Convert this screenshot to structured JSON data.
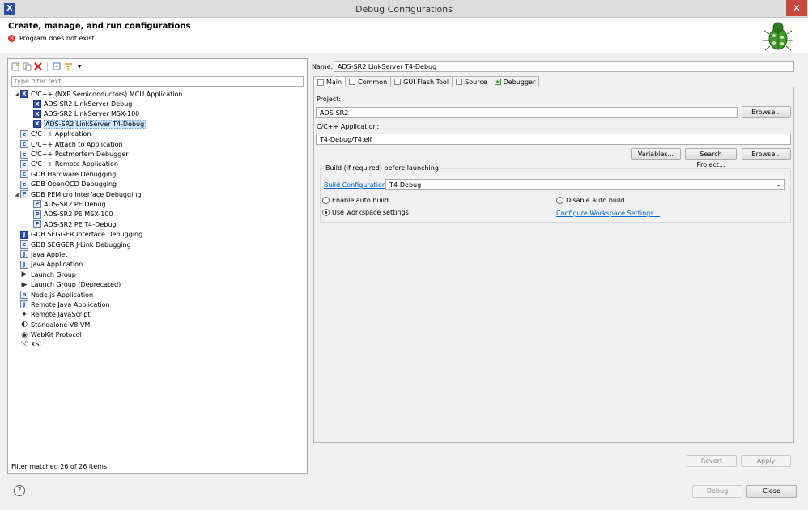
{
  "window": {
    "title": "Debug Configurations",
    "close_glyph": "✕"
  },
  "header": {
    "title": "Create, manage, and run configurations",
    "error_message": "Program does not exist",
    "icon": "bug-icon"
  },
  "left": {
    "toolbar_icons": [
      "new-config-icon",
      "duplicate-icon",
      "delete-icon",
      "collapse-all-icon",
      "filter-icon",
      "dropdown-arrow-icon"
    ],
    "filter_placeholder": "type filter text",
    "tree": [
      {
        "label": "C/C++ (NXP Semiconductors) MCU Application",
        "expanded": true,
        "icon": "mcu-app-icon",
        "children": [
          {
            "label": "ADS-SR2 LinkServer Debug",
            "icon": "mcu-config-icon"
          },
          {
            "label": "ADS-SR2 LinkServer MSX-100",
            "icon": "mcu-config-icon"
          },
          {
            "label": "ADS-SR2 LinkServer T4-Debug",
            "icon": "mcu-config-icon",
            "selected": true
          }
        ]
      },
      {
        "label": "C/C++ Application",
        "icon": "c-app-icon"
      },
      {
        "label": "C/C++ Attach to Application",
        "icon": "c-attach-icon"
      },
      {
        "label": "C/C++ Postmortem Debugger",
        "icon": "c-postmortem-icon"
      },
      {
        "label": "C/C++ Remote Application",
        "icon": "c-remote-icon"
      },
      {
        "label": "GDB Hardware Debugging",
        "icon": "gdb-hw-icon"
      },
      {
        "label": "GDB OpenOCD Debugging",
        "icon": "gdb-openocd-icon"
      },
      {
        "label": "GDB PEMicro Interface Debugging",
        "expanded": true,
        "icon": "pemicro-icon",
        "children": [
          {
            "label": "ADS-SR2 PE Debug",
            "icon": "pe-config-icon"
          },
          {
            "label": "ADS-SR2 PE MSX-100",
            "icon": "pe-config-icon"
          },
          {
            "label": "ADS-SR2 PE T4-Debug",
            "icon": "pe-config-icon"
          }
        ]
      },
      {
        "label": "GDB SEGGER Interface Debugging",
        "icon": "segger-icon"
      },
      {
        "label": "GDB SEGGER J-Link Debugging",
        "icon": "jlink-icon"
      },
      {
        "label": "Java Applet",
        "icon": "java-applet-icon"
      },
      {
        "label": "Java Application",
        "icon": "java-app-icon"
      },
      {
        "label": "Launch Group",
        "icon": "launch-group-icon"
      },
      {
        "label": "Launch Group (Deprecated)",
        "icon": "launch-group-deprecated-icon"
      },
      {
        "label": "Node.js Application",
        "icon": "nodejs-icon"
      },
      {
        "label": "Remote Java Application",
        "icon": "remote-java-icon"
      },
      {
        "label": "Remote JavaScript",
        "icon": "remote-js-icon"
      },
      {
        "label": "Standalone V8 VM",
        "icon": "v8-icon"
      },
      {
        "label": "WebKit Protocol",
        "icon": "webkit-icon"
      },
      {
        "label": "XSL",
        "icon": "xsl-icon"
      }
    ],
    "status": "Filter matched 26 of 26 items"
  },
  "right": {
    "name_label": "Name:",
    "name_value": "ADS-SR2 LinkServer T4-Debug",
    "tabs": [
      {
        "label": "Main",
        "active": true,
        "icon": "main-tab-icon"
      },
      {
        "label": "Common",
        "icon": "common-tab-icon"
      },
      {
        "label": "GUI Flash Tool",
        "icon": "flash-tool-icon"
      },
      {
        "label": "Source",
        "icon": "source-tab-icon"
      },
      {
        "label": "Debugger",
        "icon": "debugger-tab-icon"
      }
    ],
    "project_label": "Project:",
    "project_value": "ADS-SR2",
    "browse_label": "Browse...",
    "app_label": "C/C++ Application:",
    "app_value": "T4-Debug/T4.elf",
    "variables_label": "Variables...",
    "search_project_label": "Search Project...",
    "build_group_title": "Build (if required) before launching",
    "build_config_link": "Build Configuration:",
    "build_config_value": "T4-Debug",
    "enable_auto_build": "Enable auto build",
    "disable_auto_build": "Disable auto build",
    "use_workspace": "Use workspace settings",
    "configure_workspace_link": "Configure Workspace Settings...",
    "revert_label": "Revert",
    "apply_label": "Apply"
  },
  "footer": {
    "help_glyph": "?",
    "debug_label": "Debug",
    "close_label": "Close"
  }
}
